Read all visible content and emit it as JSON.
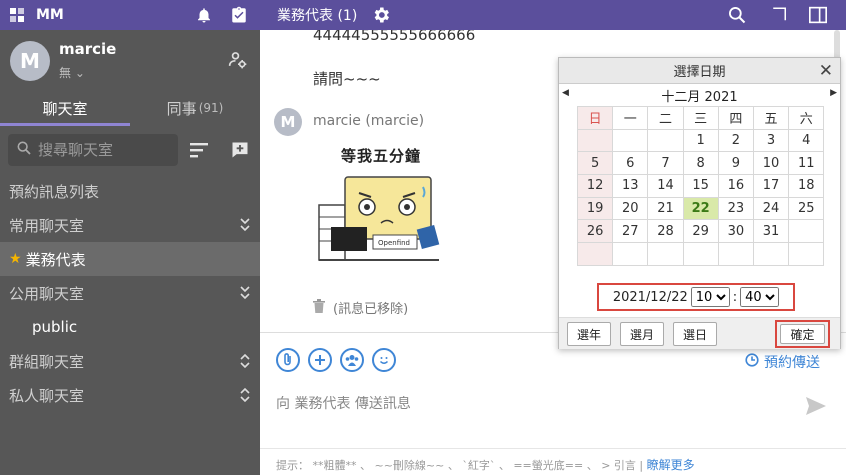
{
  "app": {
    "title": "MM"
  },
  "channel_header": {
    "title": "業務代表 (1)"
  },
  "user": {
    "initial": "M",
    "name": "marcie",
    "status": "無 ⌄"
  },
  "tabs": [
    {
      "label": "聊天室"
    },
    {
      "label": "同事",
      "count": "(91)"
    }
  ],
  "search": {
    "placeholder": "搜尋聊天室"
  },
  "sidebar": {
    "scheduled": "預約訊息列表",
    "favorites": "常用聊天室",
    "active_channel": "業務代表",
    "public_group": "公用聊天室",
    "public_item": "public",
    "groups": "群組聊天室",
    "private": "私人聊天室"
  },
  "messages": {
    "line1": "44444555555666666",
    "line2": "請問~~~",
    "sender_initial": "M",
    "sender": "marcie (marcie)",
    "sticker_caption": "等我五分鐘",
    "removed": "(訊息已移除)"
  },
  "composer": {
    "schedule_send": "預約傳送",
    "placeholder": "向 業務代表 傳送訊息",
    "hint": "提示： **粗體** 、 ~~刪除線~~ 、 `紅字` 、 ==螢光底== 、 > 引言   |",
    "learn_more": "瞭解更多"
  },
  "date_dialog": {
    "title": "選擇日期",
    "month_label": "十二月 2021",
    "weekdays": [
      "日",
      "一",
      "二",
      "三",
      "四",
      "五",
      "六"
    ],
    "weeks": [
      [
        "",
        "",
        "",
        "1",
        "2",
        "3",
        "4"
      ],
      [
        "5",
        "6",
        "7",
        "8",
        "9",
        "10",
        "11"
      ],
      [
        "12",
        "13",
        "14",
        "15",
        "16",
        "17",
        "18"
      ],
      [
        "19",
        "20",
        "21",
        "22",
        "23",
        "24",
        "25"
      ],
      [
        "26",
        "27",
        "28",
        "29",
        "30",
        "31",
        ""
      ],
      [
        "",
        "",
        "",
        "",
        "",
        "",
        ""
      ]
    ],
    "selected_day": "22",
    "selected_date": "2021/12/22",
    "hour": "10",
    "minute": "40",
    "time_separator": ":",
    "buttons": {
      "year": "選年",
      "month": "選月",
      "day": "選日",
      "confirm": "確定"
    }
  },
  "colors": {
    "header": "#5b4f9c",
    "sidebar": "#575757",
    "accent": "#3f86d6",
    "highlight_box": "#d9473f",
    "today": "#d9e9a9"
  }
}
